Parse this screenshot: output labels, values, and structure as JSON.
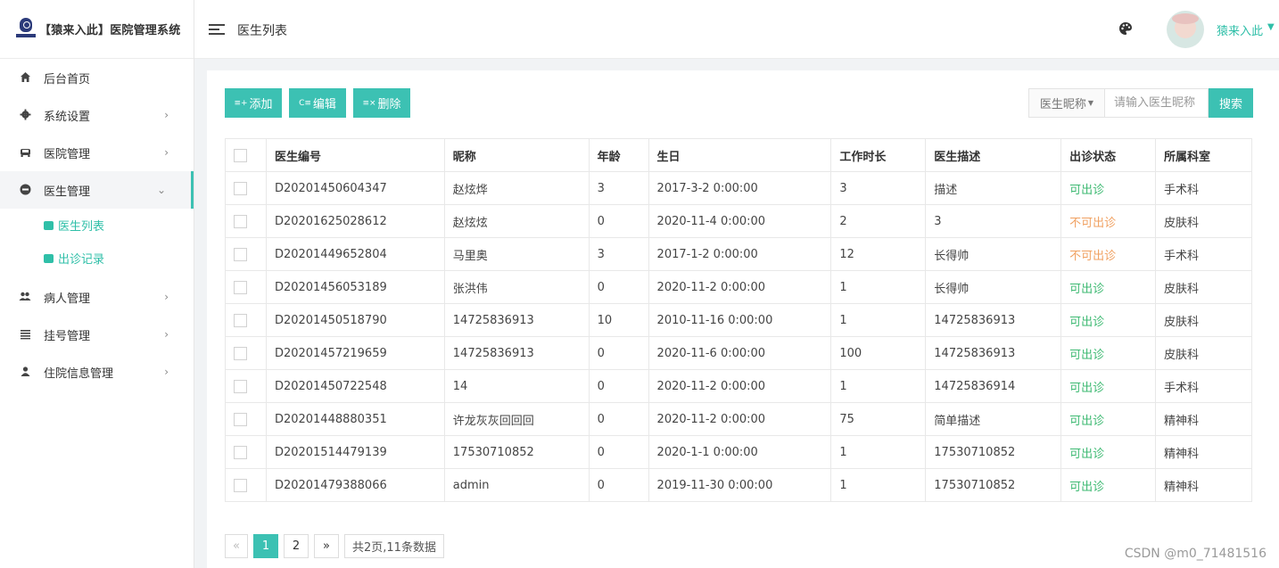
{
  "app": {
    "title": "【猿来入此】医院管理系统"
  },
  "sidebar": {
    "items": [
      {
        "label": "后台首页",
        "icon": "home-icon",
        "expandable": false
      },
      {
        "label": "系统设置",
        "icon": "gear-icon",
        "expandable": true
      },
      {
        "label": "医院管理",
        "icon": "car-icon",
        "expandable": true
      },
      {
        "label": "医生管理",
        "icon": "minus-circle-icon",
        "expandable": true,
        "expanded": true
      },
      {
        "label": "病人管理",
        "icon": "users-icon",
        "expandable": true
      },
      {
        "label": "挂号管理",
        "icon": "list-icon",
        "expandable": true
      },
      {
        "label": "住院信息管理",
        "icon": "user-icon",
        "expandable": true
      }
    ],
    "submenu": [
      {
        "label": "医生列表",
        "icon": "id-card-icon"
      },
      {
        "label": "出诊记录",
        "icon": "folder-icon"
      }
    ]
  },
  "header": {
    "breadcrumb": "医生列表",
    "user_name": "猿来入此"
  },
  "toolbar": {
    "add_label": "添加",
    "edit_label": "编辑",
    "delete_label": "删除",
    "search_field": "医生昵称",
    "search_placeholder": "请输入医生昵称",
    "search_label": "搜索"
  },
  "table": {
    "headers": [
      "医生编号",
      "昵称",
      "年龄",
      "生日",
      "工作时长",
      "医生描述",
      "出诊状态",
      "所属科室"
    ],
    "rows": [
      [
        "D20201450604347",
        "赵炫烨",
        "3",
        "2017-3-2 0:00:00",
        "3",
        "描述",
        "可出诊",
        "手术科"
      ],
      [
        "D20201625028612",
        "赵炫炫",
        "0",
        "2020-11-4 0:00:00",
        "2",
        "3",
        "不可出诊",
        "皮肤科"
      ],
      [
        "D20201449652804",
        "马里奥",
        "3",
        "2017-1-2 0:00:00",
        "12",
        "长得帅",
        "不可出诊",
        "手术科"
      ],
      [
        "D20201456053189",
        "张洪伟",
        "0",
        "2020-11-2 0:00:00",
        "1",
        "长得帅",
        "可出诊",
        "皮肤科"
      ],
      [
        "D20201450518790",
        "14725836913",
        "10",
        "2010-11-16 0:00:00",
        "1",
        "14725836913",
        "可出诊",
        "皮肤科"
      ],
      [
        "D20201457219659",
        "14725836913",
        "0",
        "2020-11-6 0:00:00",
        "100",
        "14725836913",
        "可出诊",
        "皮肤科"
      ],
      [
        "D20201450722548",
        "14",
        "0",
        "2020-11-2 0:00:00",
        "1",
        "14725836914",
        "可出诊",
        "手术科"
      ],
      [
        "D20201448880351",
        "许龙灰灰回回回",
        "0",
        "2020-11-2 0:00:00",
        "75",
        "简单描述",
        "可出诊",
        "精神科"
      ],
      [
        "D20201514479139",
        "17530710852",
        "0",
        "2020-1-1 0:00:00",
        "1",
        "17530710852",
        "可出诊",
        "精神科"
      ],
      [
        "D20201479388066",
        "admin",
        "0",
        "2019-11-30 0:00:00",
        "1",
        "17530710852",
        "可出诊",
        "精神科"
      ]
    ]
  },
  "pagination": {
    "prev": "«",
    "pages": [
      "1",
      "2"
    ],
    "current": "1",
    "next": "»",
    "info": "共2页,11条数据"
  },
  "watermark": "CSDN @m0_71481516",
  "colors": {
    "accent": "#3cc1b3",
    "available": "#3cb971",
    "unavailable": "#f0a060"
  }
}
